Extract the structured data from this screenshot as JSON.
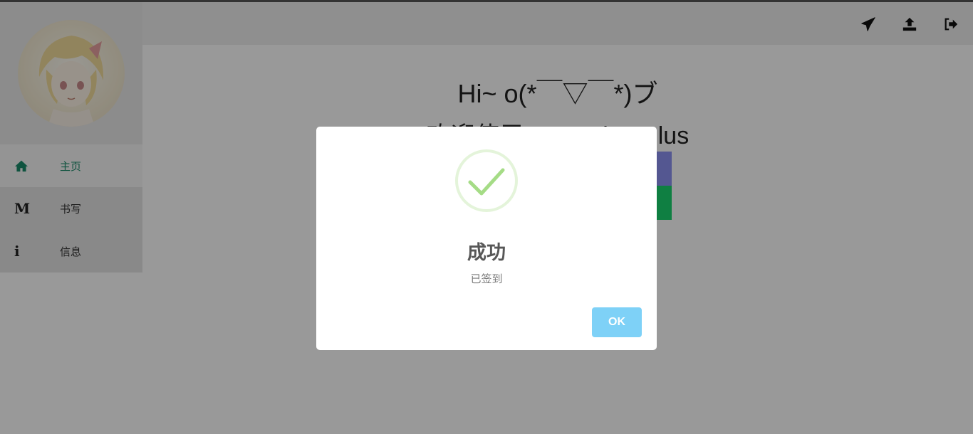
{
  "header": {
    "icons": [
      "paper-plane-icon",
      "upload-icon",
      "sign-out-icon"
    ]
  },
  "sidebar": {
    "items": [
      {
        "icon": "home-icon",
        "label": "主页",
        "active": true
      },
      {
        "icon": "markdown-icon",
        "glyph": "M",
        "label": "书写",
        "active": false
      },
      {
        "icon": "info-icon",
        "glyph": "i",
        "label": "信息",
        "active": false
      }
    ]
  },
  "main": {
    "greeting": "Hi~ o(*￣▽￣*)ブ",
    "welcome": "欢迎使用Hexo Blog Plus"
  },
  "modal": {
    "icon": "check-circle-icon",
    "title": "成功",
    "text": "已签到",
    "ok_label": "OK"
  },
  "colors": {
    "active_nav": "#1a8a6a",
    "purple_button": "#8c91f2",
    "green_button": "#19d46e",
    "ok_button": "#7ed1f7",
    "success_check": "#a5dc86"
  }
}
